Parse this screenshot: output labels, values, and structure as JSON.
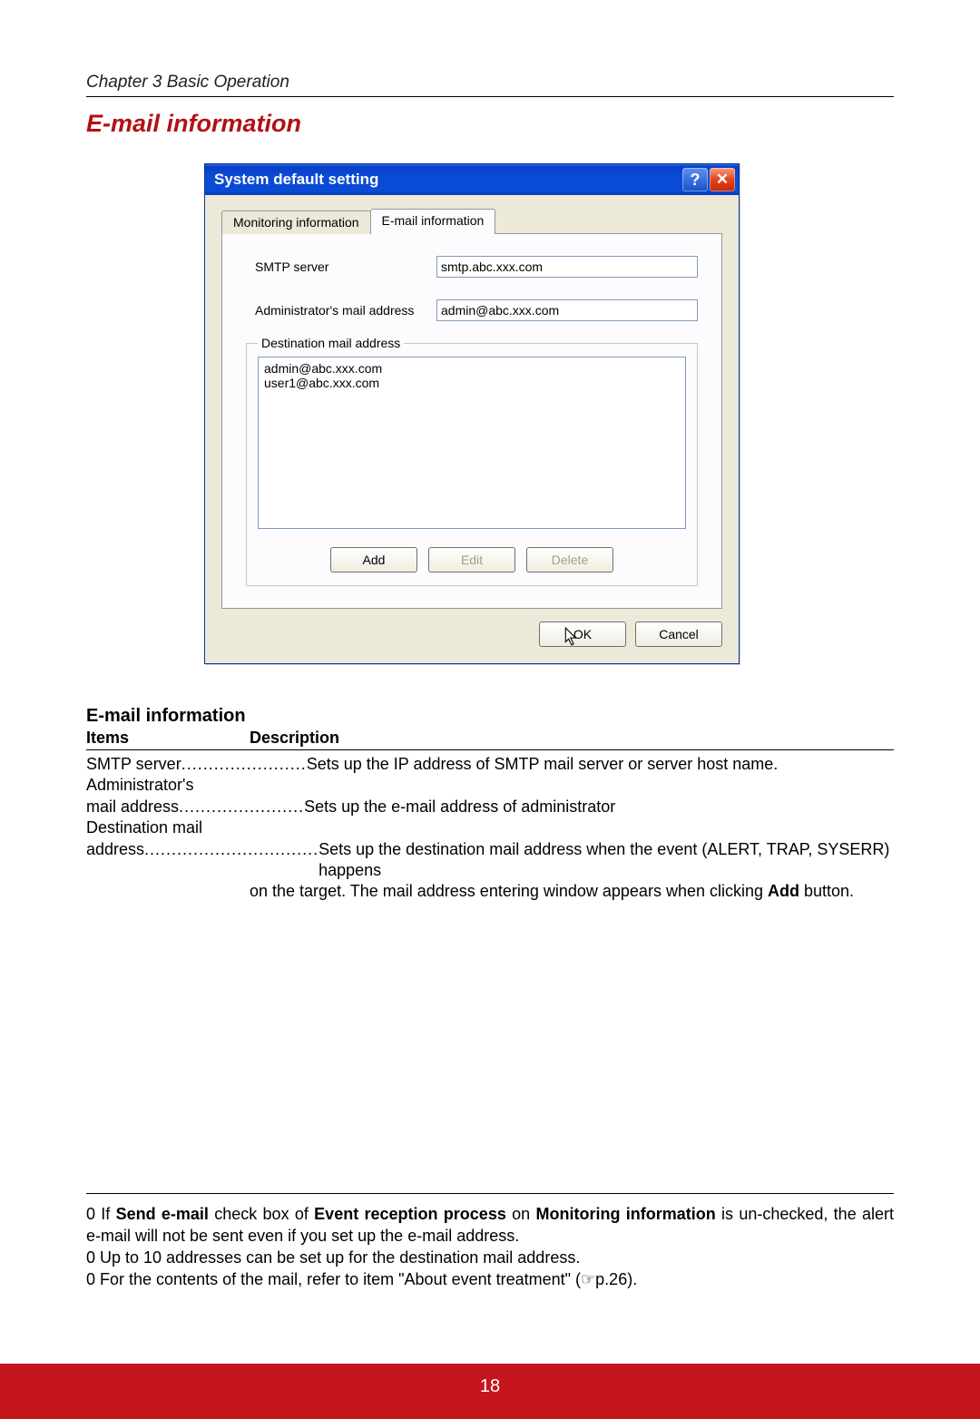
{
  "page": {
    "chapter": "Chapter 3 Basic Operation",
    "section_title": "E-mail information",
    "page_number": "18"
  },
  "dialog": {
    "title": "System default setting",
    "tabs": {
      "monitoring": "Monitoring information",
      "email": "E-mail information"
    },
    "smtp_label": "SMTP server",
    "smtp_value": "smtp.abc.xxx.com",
    "admin_label": "Administrator's mail address",
    "admin_value": "admin@abc.xxx.com",
    "dest_legend": "Destination mail address",
    "dest_list": "admin@abc.xxx.com\nuser1@abc.xxx.com",
    "buttons": {
      "add": "Add",
      "edit": "Edit",
      "delete": "Delete",
      "ok": "OK",
      "cancel": "Cancel"
    }
  },
  "desc": {
    "subtitle": "E-mail information",
    "col_items": "Items",
    "col_desc": "Description",
    "rows": {
      "smtp_item": "SMTP server",
      "smtp_dots": ".......................",
      "smtp_text": "Sets up the IP address of SMTP mail server or server host name.",
      "admin_line1": "Administrator's",
      "admin_item": "mail address",
      "admin_dots": ".......................",
      "admin_text": "Sets up the e-mail address of administrator",
      "dest_line1": "Destination mail",
      "dest_item": "address",
      "dest_dots": "................................",
      "dest_text1": "Sets up the destination mail address when the event (ALERT, TRAP, SYSERR) happens",
      "dest_text2_a": "on the target. The mail address entering window appears when clicking ",
      "dest_text2_b": "Add",
      "dest_text2_c": " button."
    }
  },
  "footnotes": {
    "f1_a": "0 If ",
    "f1_b": "Send e-mail",
    "f1_c": " check box of ",
    "f1_d": "Event reception process",
    "f1_e": " on ",
    "f1_f": "Monitoring information",
    "f1_g": " is un-checked, the alert e-mail will not be sent even if you set up the e-mail address.",
    "f2": "0 Up to 10 addresses can be set up for the destination mail address.",
    "f3": "0 For the contents of the mail, refer to item \"About event treatment\" (☞p.26)."
  }
}
